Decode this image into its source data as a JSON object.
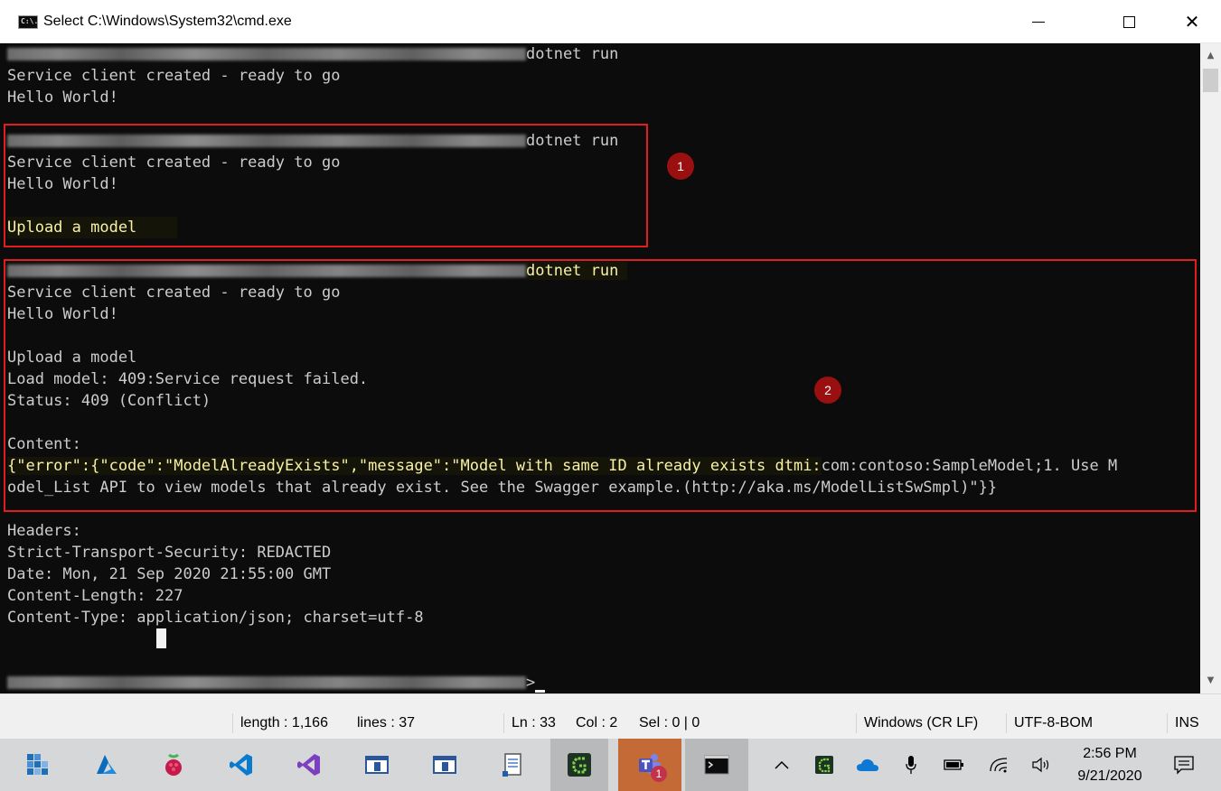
{
  "window": {
    "title": "Select C:\\Windows\\System32\\cmd.exe",
    "icon_text": "C:\\."
  },
  "console": {
    "lines": [
      {
        "text": "dotnet run",
        "prompt": true
      },
      {
        "text": "Service client created - ready to go"
      },
      {
        "text": "Hello World!"
      },
      {
        "text": ""
      },
      {
        "text": "dotnet run",
        "prompt": true
      },
      {
        "text": "Service client created - ready to go"
      },
      {
        "text": "Hello World!"
      },
      {
        "text": ""
      },
      {
        "text": "Upload a model",
        "highlight": true
      },
      {
        "text": "dotnet run",
        "prompt": true,
        "highlight": true
      },
      {
        "text": "Service client created - ready to go"
      },
      {
        "text": "Hello World!"
      },
      {
        "text": ""
      },
      {
        "text": "Upload a model"
      },
      {
        "text": "Load model: 409:Service request failed."
      },
      {
        "text": "Status: 409 (Conflict)"
      },
      {
        "text": ""
      },
      {
        "text": "Content:"
      },
      {
        "text": "{\"error\":{\"code\":\"ModelAlreadyExists\",\"message\":\"Model with same ID already exists dtmi:",
        "text_b": "com:contoso:SampleModel;1. Use M",
        "highlight": true
      },
      {
        "text": "odel_List API to view models that already exist. See the Swagger example.(http://aka.ms/ModelListSwSmpl)\"}}"
      },
      {
        "text": ""
      },
      {
        "text": "Headers:"
      },
      {
        "text": "Strict-Transport-Security: REDACTED"
      },
      {
        "text": "Date: Mon, 21 Sep 2020 21:55:00 GMT"
      },
      {
        "text": "Content-Length: 227"
      },
      {
        "text": "Content-Type: application/json; charset=utf-8"
      },
      {
        "text": ""
      },
      {
        "text": ""
      },
      {
        "text": ">",
        "prompt": true,
        "caret": true
      }
    ]
  },
  "annotations": [
    {
      "label": "1"
    },
    {
      "label": "2"
    }
  ],
  "status_bar": {
    "length": "length : 1,166",
    "lines": "lines : 37",
    "ln": "Ln : 33",
    "col": "Col : 2",
    "sel": "Sel : 0 | 0",
    "eol": "Windows (CR LF)",
    "encoding": "UTF-8-BOM",
    "mode": "INS"
  },
  "taskbar": {
    "apps": [
      "task-view",
      "azure",
      "raspberry-pi",
      "vscode",
      "visual-studio",
      "window-app",
      "window-app-2",
      "notepad",
      "gitkraken",
      "teams",
      "cmd"
    ],
    "teams_badge": "1",
    "clock_time": "2:56 PM",
    "clock_date": "9/21/2020",
    "colors": {
      "accent": "#c46a37",
      "console_bg": "#0c0c0c",
      "console_text": "#cccccc",
      "highlight_text": "#f9f1a5",
      "annotation": "#e21d1d"
    }
  }
}
